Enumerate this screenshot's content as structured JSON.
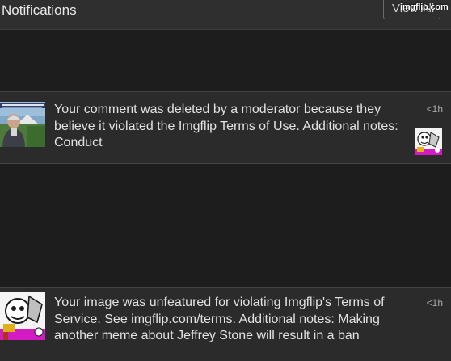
{
  "header": {
    "title": "Notifications",
    "view_all_label": "View All"
  },
  "watermark": "imgflip.com",
  "notifications": [
    {
      "text": "Your comment was deleted by a moderator because they believe it violated the Imgflip Terms of Use. Additional notes: Conduct",
      "time": "<1h",
      "thumb_icon": "meme-thumbnail-man-outdoors",
      "side_icon": "meme-thumbnail-cartoon"
    },
    {
      "text": "Your image was unfeatured for violating Imgflip's Terms of Service. See imgflip.com/terms. Additional notes: Making another meme about Jeffrey Stone will result in a ban",
      "time": "<1h",
      "thumb_icon": "meme-thumbnail-cartoon"
    }
  ]
}
